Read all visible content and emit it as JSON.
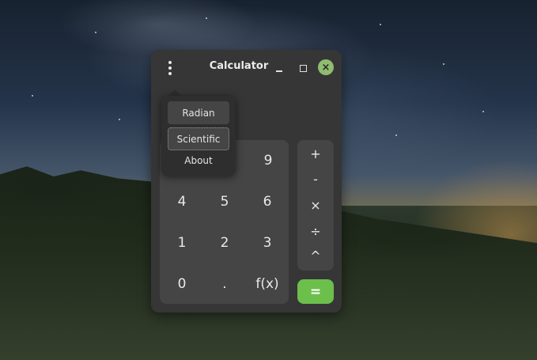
{
  "window": {
    "title": "Calculator",
    "menu_icon": "vertical-dots-icon",
    "minimize_icon": "minimize-icon",
    "maximize_icon": "maximize-icon",
    "close_icon": "close-icon",
    "close_glyph": "×",
    "accent_color": "#6cbf4a"
  },
  "menu": {
    "items": [
      "Radian",
      "Scientific",
      "About"
    ]
  },
  "keypad": {
    "keys": [
      "9",
      "4",
      "5",
      "6",
      "1",
      "2",
      "3",
      "0",
      ".",
      "f(x)"
    ]
  },
  "operators": {
    "keys": [
      "+",
      "-",
      "×",
      "÷",
      "^"
    ],
    "equals": "="
  }
}
